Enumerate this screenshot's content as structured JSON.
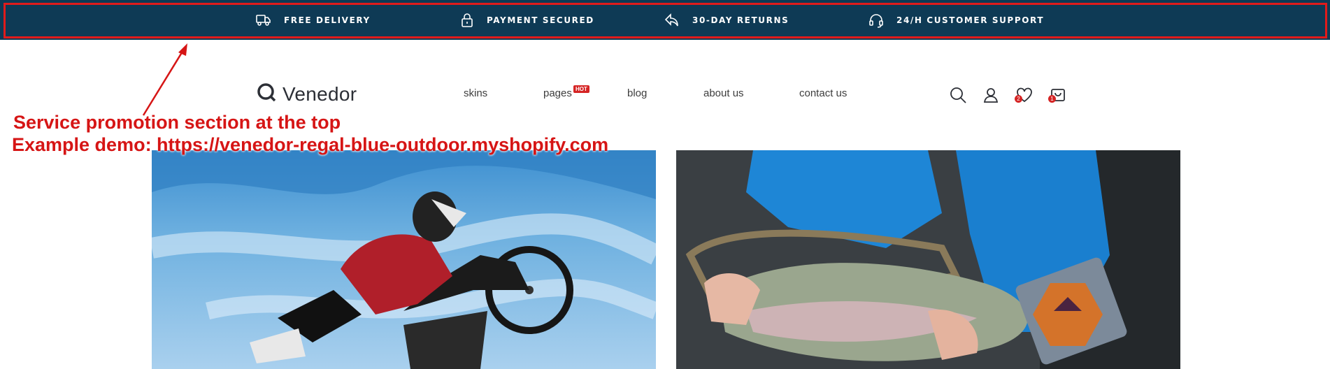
{
  "promo_bar": {
    "background": "#0e3a55",
    "items": [
      {
        "icon": "truck-icon",
        "label": "FREE DELIVERY"
      },
      {
        "icon": "lock-icon",
        "label": "PAYMENT SECURED"
      },
      {
        "icon": "return-arrow-icon",
        "label": "30-DAY RETURNS"
      },
      {
        "icon": "headset-icon",
        "label": "24/H CUSTOMER SUPPORT"
      }
    ]
  },
  "header": {
    "logo_text": "Venedor",
    "nav": [
      {
        "label": "skins"
      },
      {
        "label": "pages",
        "badge": "HOT"
      },
      {
        "label": "blog"
      },
      {
        "label": "about us"
      },
      {
        "label": "contact us"
      }
    ],
    "icons": [
      "search-icon",
      "user-icon",
      "wishlist-heart-icon",
      "cart-icon"
    ],
    "wishlist_count": "2",
    "cart_count": "1"
  },
  "banners": [
    {
      "subject": "motocross-rider-image"
    },
    {
      "subject": "fishing-trout-image"
    }
  ],
  "annotation": {
    "color": "#d61515",
    "line1": "Service promotion section at the top",
    "line2": "Example demo: https://venedor-regal-blue-outdoor.myshopify.com"
  }
}
